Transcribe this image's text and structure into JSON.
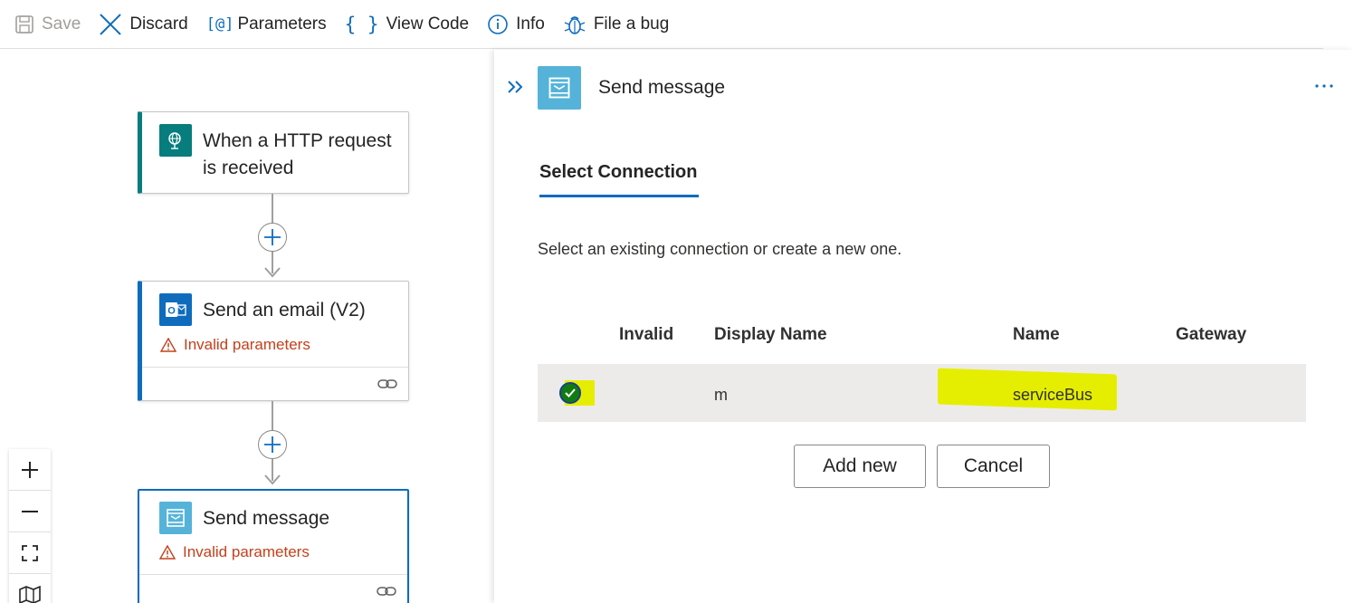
{
  "toolbar": {
    "save": "Save",
    "discard": "Discard",
    "parameters_glyph": "[@]",
    "parameters": "Parameters",
    "view_code_glyph": "{ }",
    "view_code": "View Code",
    "info": "Info",
    "file_bug": "File a bug"
  },
  "canvas": {
    "cards": [
      {
        "title_line1": "When a HTTP request",
        "title_line2": "is received",
        "accent": "#077d7d",
        "icon": "http-request-icon"
      },
      {
        "title": "Send an email (V2)",
        "warning": "Invalid parameters",
        "accent": "#0f6cbd",
        "icon": "outlook-icon"
      },
      {
        "title": "Send message",
        "warning": "Invalid parameters",
        "accent": "#0f6cbd",
        "icon": "service-bus-icon"
      }
    ]
  },
  "panel": {
    "title": "Send message",
    "tab": "Select Connection",
    "description": "Select an existing connection or create a new one.",
    "columns": [
      "Invalid",
      "Display Name",
      "Name",
      "Gateway"
    ],
    "rows": [
      {
        "display_name": "m",
        "name": "serviceBus",
        "gateway": ""
      }
    ],
    "add_new": "Add new",
    "cancel": "Cancel"
  },
  "colors": {
    "accent": "#0f6cbd",
    "warning": "#c4401b",
    "highlight": "#e6ee00",
    "trigger_teal": "#077d7d"
  }
}
